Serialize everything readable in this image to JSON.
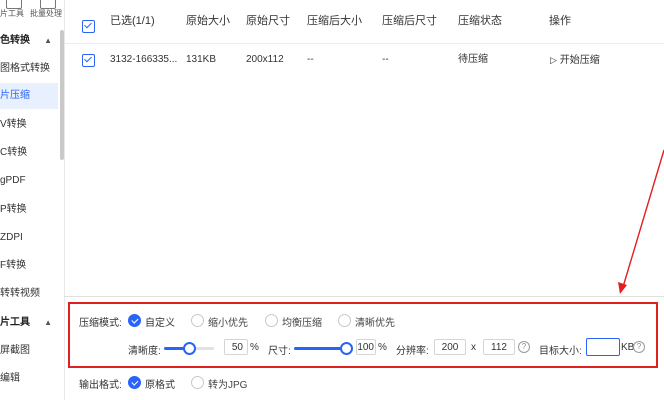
{
  "toolbar": {
    "tool_label_1": "片工具",
    "tool_label_2": "批量处理"
  },
  "sidebar": {
    "section1": "色转换",
    "items1": [
      "图格式转换",
      "片压缩",
      "V转换",
      "C转换",
      "gPDF",
      "P转换",
      "ZDPI",
      "F转换",
      "转转视频"
    ],
    "section2": "片工具",
    "items2": [
      "屏截图",
      "编辑"
    ],
    "active_index": 1
  },
  "table": {
    "headers": {
      "selected": "已选(1/1)",
      "orig_size": "原始大小",
      "orig_dim": "原始尺寸",
      "comp_size": "压缩后大小",
      "comp_dim": "压缩后尺寸",
      "status": "压缩状态",
      "action": "操作"
    },
    "row": {
      "name": "3132-166335...",
      "orig_size": "131KB",
      "orig_dim": "200x112",
      "comp_size": "--",
      "comp_dim": "--",
      "status": "待压缩",
      "action": "开始压缩"
    }
  },
  "settings": {
    "mode_label": "压缩模式:",
    "modes": [
      "自定义",
      "缩小优先",
      "均衡压缩",
      "清晰优先"
    ],
    "selected_mode": 0,
    "clarity_label": "清晰度:",
    "clarity_value": "50",
    "clarity_fraction": 0.5,
    "percent": "%",
    "size_label": "尺寸:",
    "size_value": "100",
    "size_fraction": 1.0,
    "resolution_label": "分辨率:",
    "res_w": "200",
    "res_x": "x",
    "res_h": "112",
    "target_label": "目标大小:",
    "target_value": "",
    "target_unit": "KB",
    "output_label": "输出格式:",
    "outputs": [
      "原格式",
      "转为JPG"
    ],
    "selected_output": 0
  },
  "colors": {
    "accent": "#2a64f6",
    "highlight": "#e02020",
    "active_bg": "#e8f0fe"
  }
}
